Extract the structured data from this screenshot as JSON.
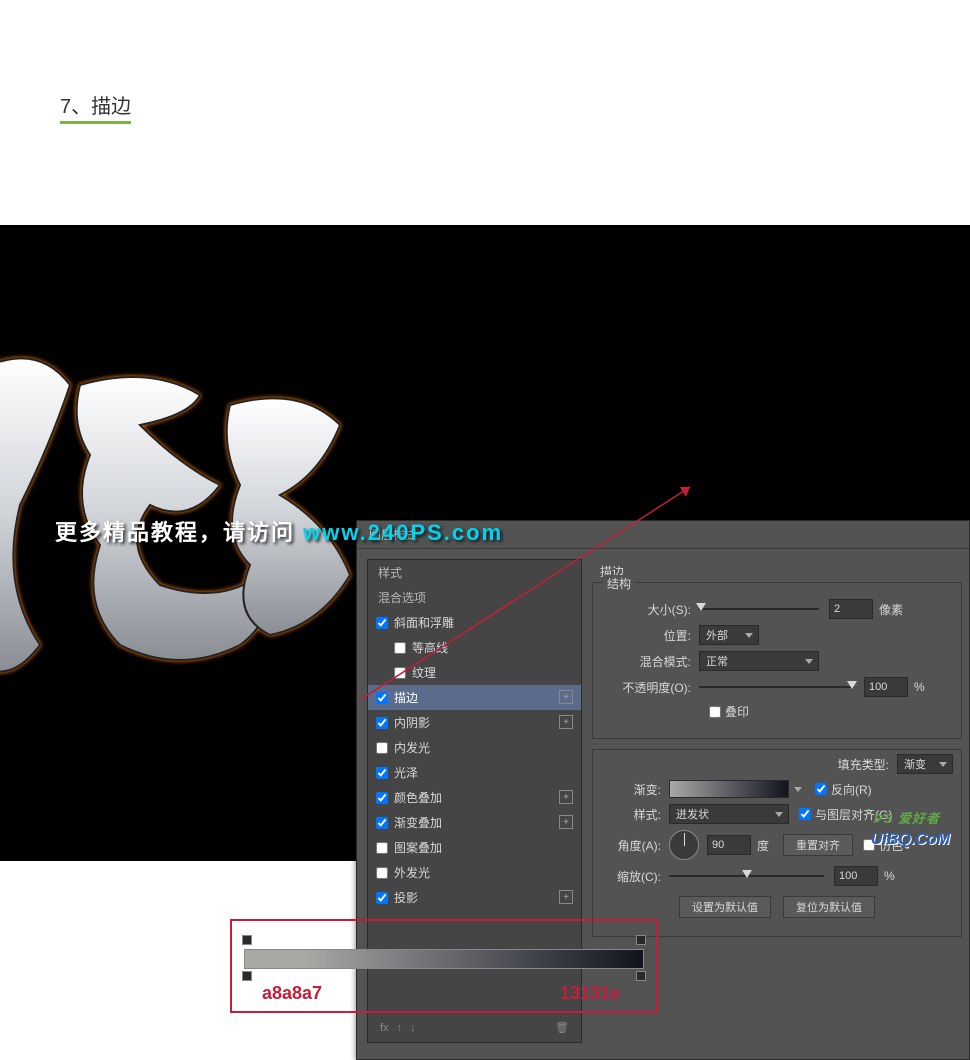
{
  "step": {
    "label": "7、描边"
  },
  "tutorial_banner": {
    "prefix": "更多精品教程，请访问 ",
    "url": "www.240PS.com"
  },
  "watermark": {
    "prefix": "更多精品教程，请访问 ",
    "url": "www.240PS.com"
  },
  "dialog": {
    "title": "图层样式"
  },
  "styles": {
    "header1": "样式",
    "header2": "混合选项",
    "bevel": "斜面和浮雕",
    "contour": "等高线",
    "texture": "纹理",
    "stroke": "描边",
    "inner_shadow": "内阴影",
    "inner_glow": "内发光",
    "satin": "光泽",
    "color_overlay": "颜色叠加",
    "gradient_overlay": "渐变叠加",
    "pattern_overlay": "图案叠加",
    "outer_glow": "外发光",
    "drop_shadow": "投影",
    "fx_label": "fx"
  },
  "stroke_panel": {
    "group_title": "描边",
    "structure_legend": "结构",
    "size_label": "大小(S):",
    "size_value": "2",
    "size_unit": "像素",
    "position_label": "位置:",
    "position_value": "外部",
    "blend_label": "混合模式:",
    "blend_value": "正常",
    "opacity_label": "不透明度(O):",
    "opacity_value": "100",
    "opacity_unit": "%",
    "overprint_label": "叠印",
    "fill_type_label": "填充类型:",
    "fill_type_value": "渐变",
    "gradient_label": "渐变:",
    "reverse_label": "反向(R)",
    "style_label": "样式:",
    "style_value": "迸发状",
    "align_label": "与图层对齐(G)",
    "angle_label": "角度(A):",
    "angle_value": "90",
    "angle_unit": "度",
    "reset_align": "重置对齐",
    "dither_label": "仿色",
    "scale_label": "缩放(C):",
    "scale_value": "100",
    "scale_unit": "%",
    "make_default": "设置为默认值",
    "reset_default": "复位为默认值"
  },
  "gradient_stops": {
    "hex1": "a8a8a7",
    "hex2": "13131e"
  },
  "watermarks": {
    "uibq": "UiBQ.CoM",
    "psahz": "PS 爱好者"
  }
}
